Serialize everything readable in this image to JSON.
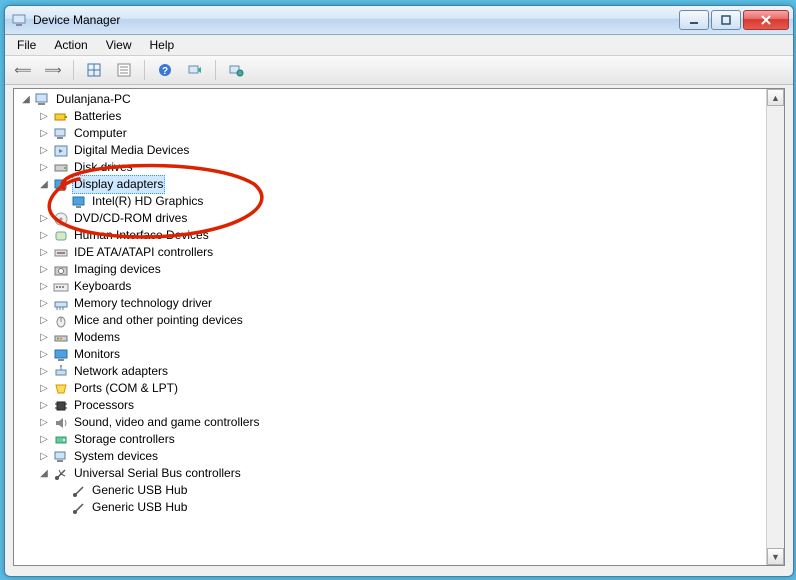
{
  "window": {
    "title": "Device Manager"
  },
  "menu": {
    "file": "File",
    "action": "Action",
    "view": "View",
    "help": "Help"
  },
  "tree": {
    "root": "Dulanjana-PC",
    "batteries": "Batteries",
    "computer": "Computer",
    "digitalmedia": "Digital Media Devices",
    "diskdrives": "Disk drives",
    "displayadapters": "Display adapters",
    "intelhd": "Intel(R) HD Graphics",
    "dvdcd": "DVD/CD-ROM drives",
    "hid": "Human Interface Devices",
    "ideata": "IDE ATA/ATAPI controllers",
    "imaging": "Imaging devices",
    "keyboards": "Keyboards",
    "memtech": "Memory technology driver",
    "mice": "Mice and other pointing devices",
    "modems": "Modems",
    "monitors": "Monitors",
    "netadapters": "Network adapters",
    "ports": "Ports (COM & LPT)",
    "processors": "Processors",
    "sound": "Sound, video and game controllers",
    "storage": "Storage controllers",
    "sysdev": "System devices",
    "usb": "Universal Serial Bus controllers",
    "usbhub1": "Generic USB Hub",
    "usbhub2": "Generic USB Hub"
  }
}
